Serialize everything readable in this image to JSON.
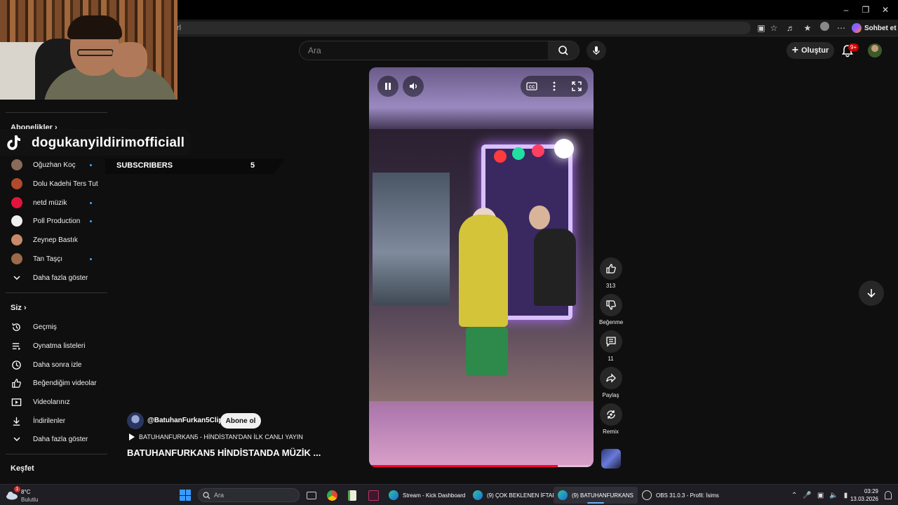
{
  "browser": {
    "url_fragment": "rl",
    "chat_label": "Sohbet et"
  },
  "header": {
    "search_placeholder": "Ara",
    "create_label": "Oluştur",
    "notif_badge": "9+"
  },
  "overlay": {
    "tiktok_handle": "dogukanyildirimofficiall",
    "subs_label": "SUBSCRIBERS",
    "subs_count": "5"
  },
  "sidebar": {
    "subscriptions_title": "Abonelikler",
    "channels": [
      {
        "label": "Oğuzhan Koç",
        "dot": true,
        "color": "#8a6a5a"
      },
      {
        "label": "Dolu Kadehi Ters Tut",
        "dot": false,
        "color": "#b04a2a"
      },
      {
        "label": "netd müzik",
        "dot": true,
        "color": "#e3143c"
      },
      {
        "label": "Poll Production",
        "dot": true,
        "color": "#f0f0f0"
      },
      {
        "label": "Zeynep Bastık",
        "dot": false,
        "color": "#c88a6a"
      },
      {
        "label": "Tan Taşçı",
        "dot": true,
        "color": "#9a6a4a"
      }
    ],
    "show_more": "Daha fazla göster",
    "you_title": "Siz",
    "you_items": [
      {
        "label": "Geçmiş",
        "icon": "history-icon"
      },
      {
        "label": "Oynatma listeleri",
        "icon": "playlist-icon"
      },
      {
        "label": "Daha sonra izle",
        "icon": "watch-later-icon"
      },
      {
        "label": "Beğendiğim videolar",
        "icon": "like-icon"
      },
      {
        "label": "Videolarınız",
        "icon": "your-videos-icon"
      },
      {
        "label": "İndirilenler",
        "icon": "download-icon"
      }
    ],
    "show_more_2": "Daha fazla göster",
    "explore_title": "Keşfet"
  },
  "video": {
    "channel": "@BatuhanFurkan5Clips",
    "subscribe_label": "Abone ol",
    "playlist": "BATUHANFURKAN5 - HİNDİSTAN'DAN İLK CANLI YAYIN",
    "title": "BATUHANFURKAN5 HİNDİSTANDA MÜZİK ...",
    "progress": 0.84
  },
  "actions": {
    "like_count": "313",
    "dislike_label": "Beğenme",
    "comment_count": "11",
    "share_label": "Paylaş",
    "remix_label": "Remix"
  },
  "taskbar": {
    "temp": "8°C",
    "weather": "Bulutlu",
    "weather_badge": "1",
    "search_placeholder": "Ara",
    "windows": [
      {
        "label": "Stream - Kick Dashboard"
      },
      {
        "label": "(9) ÇOK BEKLENEN İFTAR"
      },
      {
        "label": "(9) BATUHANFURKANS"
      },
      {
        "label": "OBS 31.0.3 - Profil: İsims"
      }
    ],
    "time": "03:29",
    "date": "13.03.2026"
  },
  "colors": {
    "accent_red": "#ff0033",
    "link_blue": "#3ea6ff"
  }
}
